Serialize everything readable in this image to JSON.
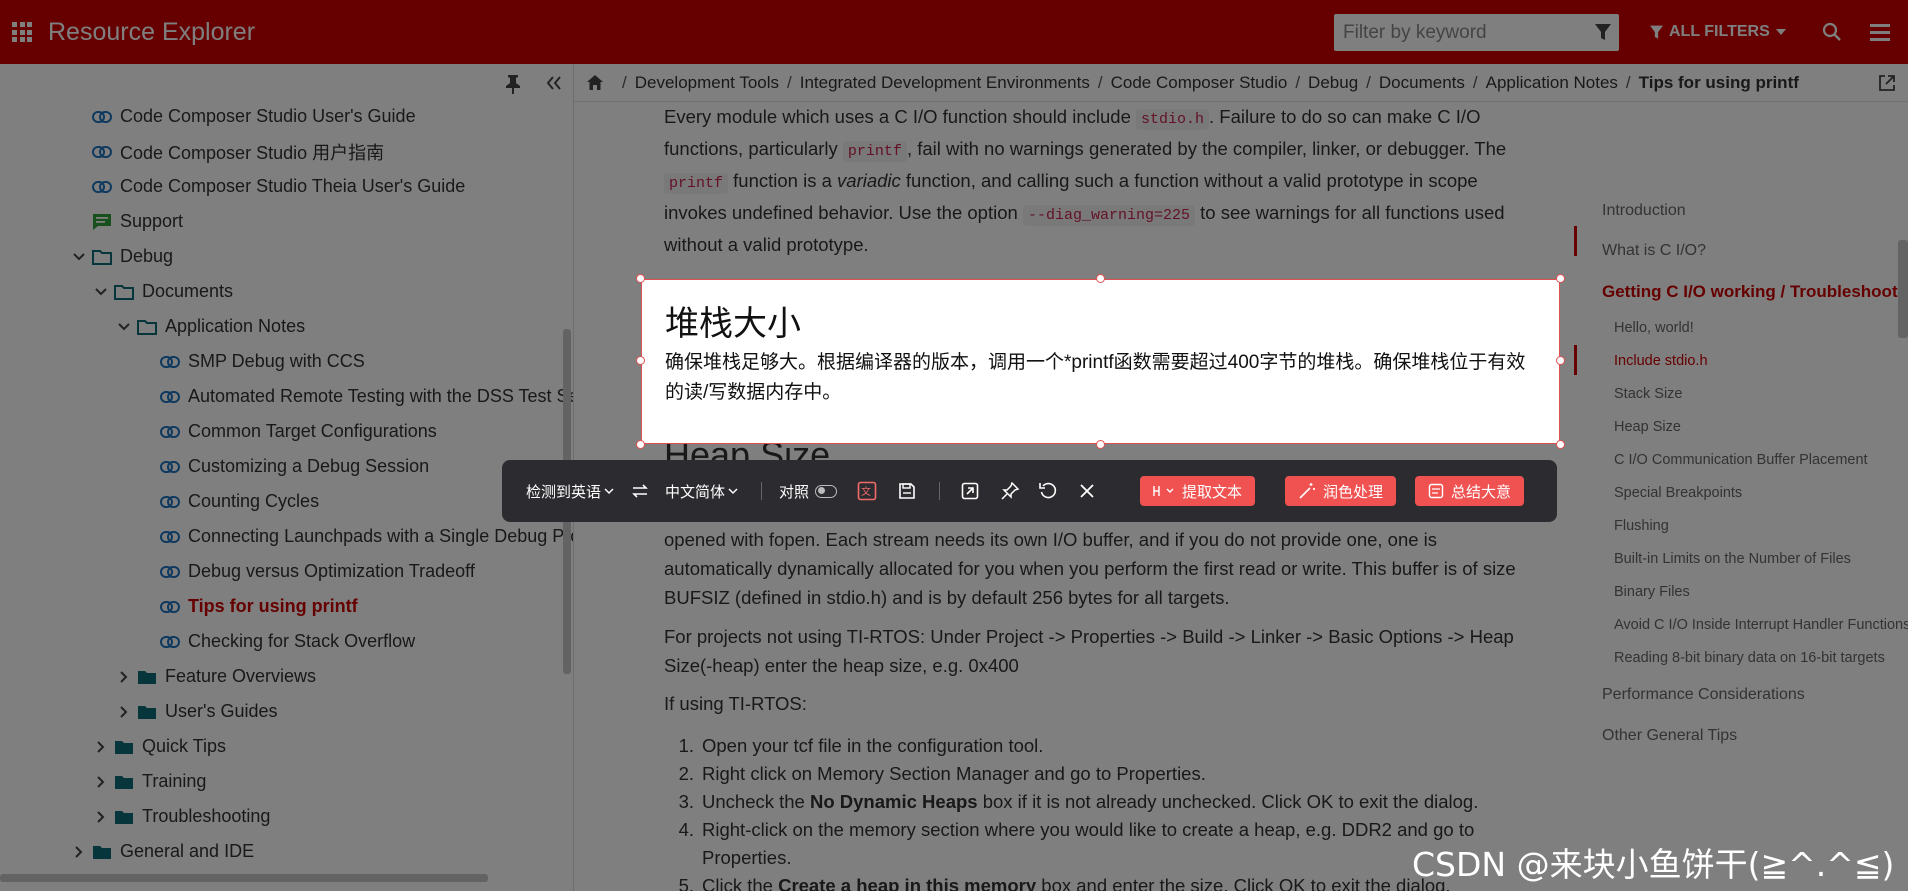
{
  "app": {
    "title": "Resource Explorer",
    "filter_placeholder": "Filter by keyword",
    "all_filters_label": "ALL FILTERS",
    "accent_color": "#cc0000"
  },
  "sidebar": {
    "items": [
      {
        "label": "Code Composer Studio User's Guide",
        "icon": "link-icon"
      },
      {
        "label": "Code Composer Studio 用户指南",
        "icon": "link-icon"
      },
      {
        "label": "Code Composer Studio Theia User's Guide",
        "icon": "link-icon"
      },
      {
        "label": "Support",
        "icon": "chat-icon"
      },
      {
        "label": "Debug",
        "icon": "folder-outline-icon"
      },
      {
        "label": "Documents",
        "icon": "folder-outline-icon"
      },
      {
        "label": "Application Notes",
        "icon": "folder-outline-icon"
      },
      {
        "label": "SMP Debug with CCS",
        "icon": "link-icon"
      },
      {
        "label": "Automated Remote Testing with the DSS Test Se",
        "icon": "link-icon"
      },
      {
        "label": "Common Target Configurations",
        "icon": "link-icon"
      },
      {
        "label": "Customizing a Debug Session",
        "icon": "link-icon"
      },
      {
        "label": "Counting Cycles",
        "icon": "link-icon"
      },
      {
        "label": "Connecting Launchpads with a Single Debug Pro",
        "icon": "link-icon"
      },
      {
        "label": "Debug versus Optimization Tradeoff",
        "icon": "link-icon"
      },
      {
        "label": "Tips for using printf",
        "icon": "link-icon",
        "active": true
      },
      {
        "label": "Checking for Stack Overflow",
        "icon": "link-icon"
      },
      {
        "label": "Feature Overviews",
        "icon": "folder-icon"
      },
      {
        "label": "User's Guides",
        "icon": "folder-icon"
      },
      {
        "label": "Quick Tips",
        "icon": "folder-icon"
      },
      {
        "label": "Training",
        "icon": "folder-icon"
      },
      {
        "label": "Troubleshooting",
        "icon": "folder-icon"
      },
      {
        "label": "General and IDE",
        "icon": "folder-icon"
      }
    ]
  },
  "breadcrumb": [
    "Development Tools",
    "Integrated Development Environments",
    "Code Composer Studio",
    "Debug",
    "Documents",
    "Application Notes",
    "Tips for using printf"
  ],
  "article": {
    "p1": {
      "t1": "Every module which uses a C I/O function should include ",
      "c1": "stdio.h",
      "t2": ". Failure to do so can make C I/O functions, particularly ",
      "c2": "printf",
      "t3": ", fail with no warnings generated by the compiler, linker, or debugger. The ",
      "c3": "printf",
      "t4": " function is a ",
      "em": "variadic",
      "t5": " function, and calling such a function without a valid prototype in scope invokes undefined behavior. Use the option ",
      "c4": "--diag_warning=225",
      "t6": " to see warnings for all functions used without a valid prototype."
    },
    "heap_heading_partial": "Heap Size",
    "p2_line1": "opened with fopen. Each stream needs its own I/O buffer, and if you do not provide one, one is",
    "p2_rest": "automatically dynamically allocated for you when you perform the first read or write. This buffer is of size BUFSIZ (defined in stdio.h) and is by default 256 bytes for all targets.",
    "p3": "For projects not using TI-RTOS: Under Project -> Properties -> Build -> Linker -> Basic Options -> Heap Size(-heap) enter the heap size, e.g. 0x400",
    "p4": "If using TI-RTOS:",
    "steps": [
      {
        "num": "1.",
        "text": "Open your tcf file in the configuration tool."
      },
      {
        "num": "2.",
        "text": "Right click on Memory Section Manager and go to Properties."
      },
      {
        "num": "3.",
        "pre": "Uncheck the ",
        "bold": "No Dynamic Heaps",
        "post": " box if it is not already unchecked. Click OK to exit the dialog."
      },
      {
        "num": "4.",
        "text": "Right-click on the memory section where you would like to create a heap, e.g. DDR2 and go to"
      },
      {
        "num": "",
        "text": "Properties."
      },
      {
        "num": "5.",
        "pre": "Click the ",
        "bold": "Create a heap in this memory",
        "post": " box and enter the size. Click OK to exit the dialog."
      }
    ]
  },
  "toc": [
    {
      "label": "Introduction",
      "level": 1
    },
    {
      "label": "What is C I/O?",
      "level": 1
    },
    {
      "label": "Getting C I/O working / Troubleshooting",
      "level": 1,
      "active": true
    },
    {
      "label": "Hello, world!",
      "level": 2
    },
    {
      "label": "Include stdio.h",
      "level": 2,
      "active": true
    },
    {
      "label": "Stack Size",
      "level": 2
    },
    {
      "label": "Heap Size",
      "level": 2
    },
    {
      "label": "C I/O Communication Buffer Placement",
      "level": 2
    },
    {
      "label": "Special Breakpoints",
      "level": 2
    },
    {
      "label": "Flushing",
      "level": 2
    },
    {
      "label": "Built-in Limits on the Number of Files",
      "level": 2
    },
    {
      "label": "Binary Files",
      "level": 2
    },
    {
      "label": "Avoid C I/O Inside Interrupt Handler Functions",
      "level": 2
    },
    {
      "label": "Reading 8-bit binary data on 16-bit targets",
      "level": 2
    },
    {
      "label": "Performance Considerations",
      "level": 1
    },
    {
      "label": "Other General Tips",
      "level": 1
    }
  ],
  "translation": {
    "title": "堆栈大小",
    "body": "确保堆栈足够大。根据编译器的版本，调用一个*printf函数需要超过400字节的堆栈。确保堆栈位于有效的读/写数据内存中。"
  },
  "snip_toolbar": {
    "source_lang": "检测到英语",
    "target_lang": "中文简体",
    "compare_label": "对照",
    "extract_text": "提取文本",
    "polish": "润色处理",
    "summarize": "总结大意",
    "button_color": "#f05252"
  },
  "watermark": "CSDN @来块小鱼饼干(≧^.^≦)"
}
